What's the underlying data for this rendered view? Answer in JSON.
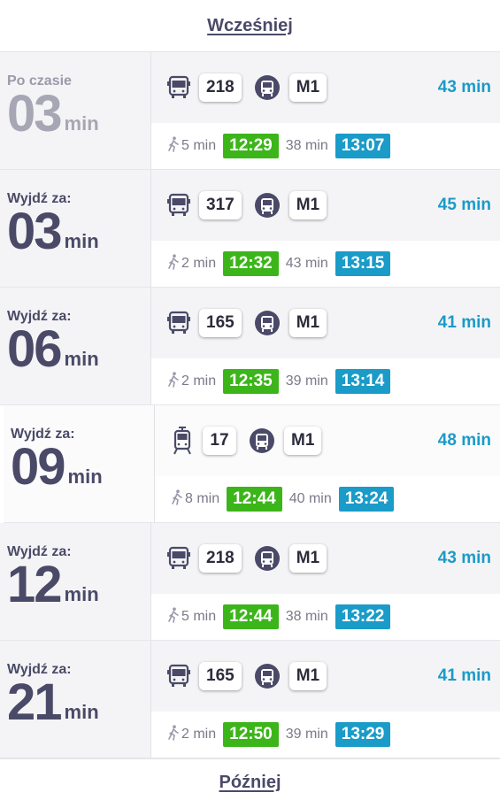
{
  "nav": {
    "earlier": "Wcześniej",
    "later": "Później"
  },
  "colors": {
    "departure": "#3cb51a",
    "arrival": "#1a9bc8",
    "total": "#1a9bc8"
  },
  "routes": [
    {
      "label": "Po czasie",
      "minutes": "03",
      "unit": "min",
      "late": true,
      "vehicle": "bus-icon",
      "line": "218",
      "metro": "M1",
      "total": "43 min",
      "walk": "5 min",
      "dep": "12:29",
      "ride": "38 min",
      "arr": "13:07"
    },
    {
      "label": "Wyjdź za:",
      "minutes": "03",
      "unit": "min",
      "late": false,
      "vehicle": "bus-icon",
      "line": "317",
      "metro": "M1",
      "total": "45 min",
      "walk": "2 min",
      "dep": "12:32",
      "ride": "43 min",
      "arr": "13:15"
    },
    {
      "label": "Wyjdź za:",
      "minutes": "06",
      "unit": "min",
      "late": false,
      "vehicle": "bus-icon",
      "line": "165",
      "metro": "M1",
      "total": "41 min",
      "walk": "2 min",
      "dep": "12:35",
      "ride": "39 min",
      "arr": "13:14"
    },
    {
      "label": "Wyjdź za:",
      "minutes": "09",
      "unit": "min",
      "late": false,
      "vehicle": "tram-icon",
      "line": "17",
      "metro": "M1",
      "total": "48 min",
      "walk": "8 min",
      "dep": "12:44",
      "ride": "40 min",
      "arr": "13:24"
    },
    {
      "label": "Wyjdź za:",
      "minutes": "12",
      "unit": "min",
      "late": false,
      "vehicle": "bus-icon",
      "line": "218",
      "metro": "M1",
      "total": "43 min",
      "walk": "5 min",
      "dep": "12:44",
      "ride": "38 min",
      "arr": "13:22"
    },
    {
      "label": "Wyjdź za:",
      "minutes": "21",
      "unit": "min",
      "late": false,
      "vehicle": "bus-icon",
      "line": "165",
      "metro": "M1",
      "total": "41 min",
      "walk": "2 min",
      "dep": "12:50",
      "ride": "39 min",
      "arr": "13:29"
    }
  ]
}
